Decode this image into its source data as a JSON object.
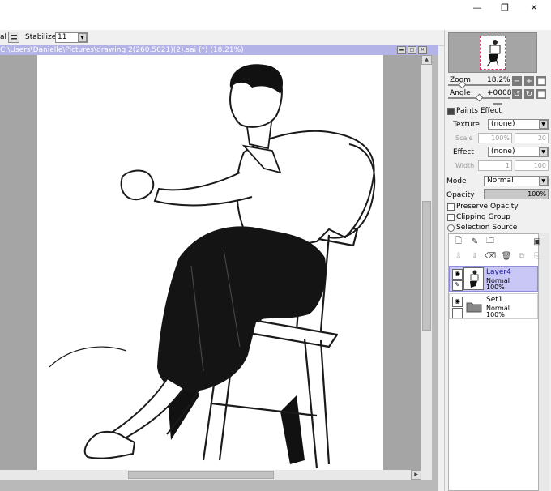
{
  "window": {
    "minimize_glyph": "—",
    "restore_glyph": "❐",
    "close_glyph": "✕"
  },
  "toolbar": {
    "left_label": "al",
    "stabilizer_label": "Stabilizer",
    "stabilizer_value": "11"
  },
  "canvas": {
    "title": "C:\\Users\\Danielle\\Pictures\\drawing 2(260.5021)(2).sai (*) (18.21%)"
  },
  "navigator": {
    "zoom_label": "Zoom",
    "zoom_value": "18.2%",
    "angle_label": "Angle",
    "angle_value": "+0008"
  },
  "paints_effect": {
    "header": "Paints Effect",
    "texture_label": "Texture",
    "texture_value": "(none)",
    "scale_label": "Scale",
    "scale_value": "100%",
    "scale_num": "20",
    "effect_label": "Effect",
    "effect_value": "(none)",
    "width_label": "Width",
    "width_value": "1",
    "width_num": "100"
  },
  "layer_props": {
    "mode_label": "Mode",
    "mode_value": "Normal",
    "opacity_label": "Opacity",
    "opacity_value": "100%",
    "opacity_level": 1.0,
    "preserve_opacity": "Preserve Opacity",
    "clipping_group": "Clipping Group",
    "selection_source": "Selection Source"
  },
  "layers": [
    {
      "name": "Layer4",
      "mode": "Normal",
      "opacity": "100%",
      "selected": true
    },
    {
      "name": "Set1",
      "mode": "Normal",
      "opacity": "100%",
      "selected": false
    }
  ],
  "colors": {
    "canvas_titlebar": "#b3b3e8",
    "selected_layer": "#c9c7f5",
    "navigator_frame": "#e0306a"
  }
}
